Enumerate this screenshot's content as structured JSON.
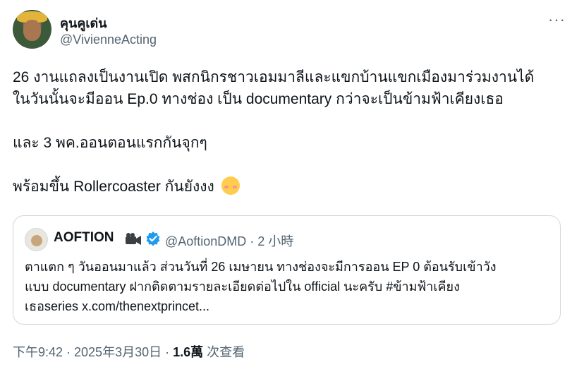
{
  "author": {
    "display_name": "คุนคูเด่น",
    "handle": "@VivienneActing"
  },
  "more_label": "···",
  "tweet": {
    "line1": "26 งานแถลงเป็นงานเปิด พสกนิกรชาวเอมมาลีและแขกบ้านแขกเมืองมาร่วมงานได้",
    "line2": "ในวันนั้นจะมีออน Ep.0 ทางช่อง เป็น documentary กว่าจะเป็นข้ามฟ้าเคียงเธอ",
    "line3": "และ 3 พค.ออนตอนแรกกันจุกๆ",
    "line4": "พร้อมขึ้น Rollercoaster กันยังงง",
    "emoji": "smiling-face-icon"
  },
  "quote": {
    "name": "AOFTION",
    "handle_time": "@AoftionDMD · 2 小時",
    "line1": "ตาแตก ๆ วันออนมาแล้ว ส่วนวันที่ 26 เมษายน ทางช่องจะมีการออน EP 0 ต้อนรับเข้าวัง",
    "line2": "แบบ documentary ฝากติดตามรายละเอียดต่อไปใน official นะครับ #ข้ามฟ้าเคียง",
    "line3": "เธอseries x.com/thenextprincet..."
  },
  "footer": {
    "timestamp": "下午9:42 · 2025年3月30日 · ",
    "views_count": "1.6萬",
    "views_label": " 次查看"
  },
  "colors": {
    "text": "#0f1419",
    "secondary": "#536471",
    "border": "#cfd9de",
    "verified": "#1d9bf0"
  }
}
